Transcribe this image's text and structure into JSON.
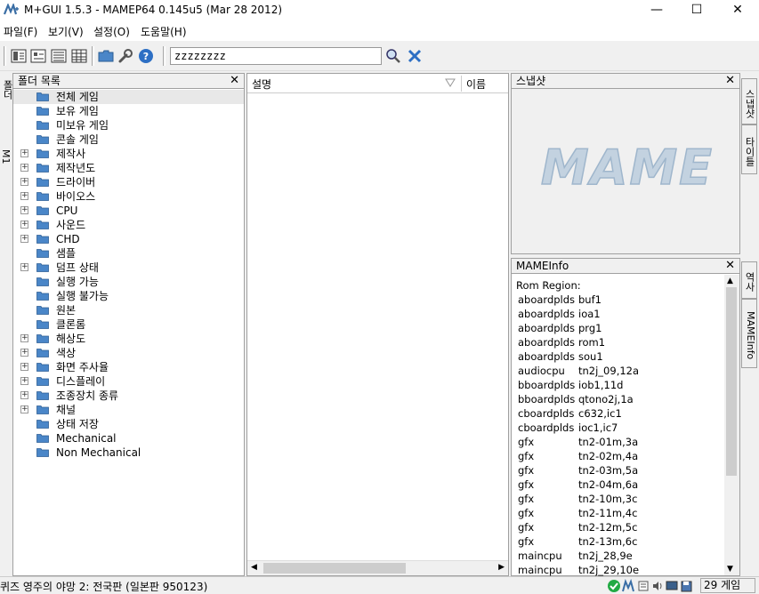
{
  "window": {
    "title": "M+GUI 1.5.3 - MAMEP64 0.145u5 (Mar 28 2012)",
    "minimize_glyph": "—",
    "maximize_glyph": "☐",
    "close_glyph": "✕"
  },
  "menu": [
    "파일(F)",
    "보기(V)",
    "설정(O)",
    "도움말(H)"
  ],
  "toolbar": {
    "search_value": "zzzzzzzz",
    "icons": [
      "view-large-icon",
      "view-small-icon",
      "view-list-icon",
      "view-details-icon",
      "folder-icon",
      "wrench-icon",
      "help-icon",
      "search-icon",
      "clear-icon"
    ]
  },
  "left_tabs": [
    "폴더",
    "M1"
  ],
  "folder_panel": {
    "title": "폴더 목록",
    "close_glyph": "✕",
    "items": [
      {
        "label": "전체 게임",
        "expandable": false,
        "selected": true
      },
      {
        "label": "보유 게임",
        "expandable": false
      },
      {
        "label": "미보유 게임",
        "expandable": false
      },
      {
        "label": "콘솔 게임",
        "expandable": false
      },
      {
        "label": "제작사",
        "expandable": true
      },
      {
        "label": "제작년도",
        "expandable": true
      },
      {
        "label": "드라이버",
        "expandable": true
      },
      {
        "label": "바이오스",
        "expandable": true
      },
      {
        "label": "CPU",
        "expandable": true
      },
      {
        "label": "사운드",
        "expandable": true
      },
      {
        "label": "CHD",
        "expandable": true
      },
      {
        "label": "샘플",
        "expandable": false
      },
      {
        "label": "덤프 상태",
        "expandable": true
      },
      {
        "label": "실행 가능",
        "expandable": false
      },
      {
        "label": "실행 불가능",
        "expandable": false
      },
      {
        "label": "원본",
        "expandable": false
      },
      {
        "label": "클론롬",
        "expandable": false
      },
      {
        "label": "해상도",
        "expandable": true
      },
      {
        "label": "색상",
        "expandable": true
      },
      {
        "label": "화면 주사율",
        "expandable": true
      },
      {
        "label": "디스플레이",
        "expandable": true
      },
      {
        "label": "조종장치 종류",
        "expandable": true
      },
      {
        "label": "채널",
        "expandable": true
      },
      {
        "label": "상태 저장",
        "expandable": false
      },
      {
        "label": "Mechanical",
        "expandable": false
      },
      {
        "label": "Non Mechanical",
        "expandable": false
      }
    ]
  },
  "game_list": {
    "col_description": "설명",
    "col_name": "이름"
  },
  "snapshot_panel": {
    "title": "스냅샷",
    "close_glyph": "✕",
    "logo_text": "MAME"
  },
  "info_panel": {
    "title": "MAMEInfo",
    "close_glyph": "✕",
    "heading": "Rom Region:",
    "rows": [
      {
        "k": "aboardplds",
        "v": "buf1"
      },
      {
        "k": "aboardplds",
        "v": "ioa1"
      },
      {
        "k": "aboardplds",
        "v": "prg1"
      },
      {
        "k": "aboardplds",
        "v": "rom1"
      },
      {
        "k": "aboardplds",
        "v": "sou1"
      },
      {
        "k": "audiocpu",
        "v": "tn2j_09,12a"
      },
      {
        "k": "bboardplds",
        "v": "iob1,11d"
      },
      {
        "k": "bboardplds",
        "v": "qtono2j,1a"
      },
      {
        "k": "cboardplds",
        "v": "c632,ic1"
      },
      {
        "k": "cboardplds",
        "v": "ioc1,ic7"
      },
      {
        "k": "gfx",
        "v": "tn2-01m,3a"
      },
      {
        "k": "gfx",
        "v": "tn2-02m,4a"
      },
      {
        "k": "gfx",
        "v": "tn2-03m,5a"
      },
      {
        "k": "gfx",
        "v": "tn2-04m,6a"
      },
      {
        "k": "gfx",
        "v": "tn2-10m,3c"
      },
      {
        "k": "gfx",
        "v": "tn2-11m,4c"
      },
      {
        "k": "gfx",
        "v": "tn2-12m,5c"
      },
      {
        "k": "gfx",
        "v": "tn2-13m,6c"
      },
      {
        "k": "maincpu",
        "v": "tn2j_28,9e"
      },
      {
        "k": "maincpu",
        "v": "tn2j_29,10e"
      }
    ]
  },
  "right_tabs": [
    "스냅샷",
    "타이틀",
    "역사",
    "MAMEInfo"
  ],
  "status": {
    "text": "퀴즈 영주의 야망 2: 전국판 (일본판 950123)",
    "count": "29 게임",
    "icons": [
      "ok-icon",
      "mame-icon",
      "list-icon",
      "sound-icon",
      "screen-icon",
      "save-icon",
      "folder-status-icon"
    ]
  },
  "colors": {
    "folder": "#4a86c8",
    "mame_logo": "#b8c8d8",
    "ok": "#22aa44"
  }
}
